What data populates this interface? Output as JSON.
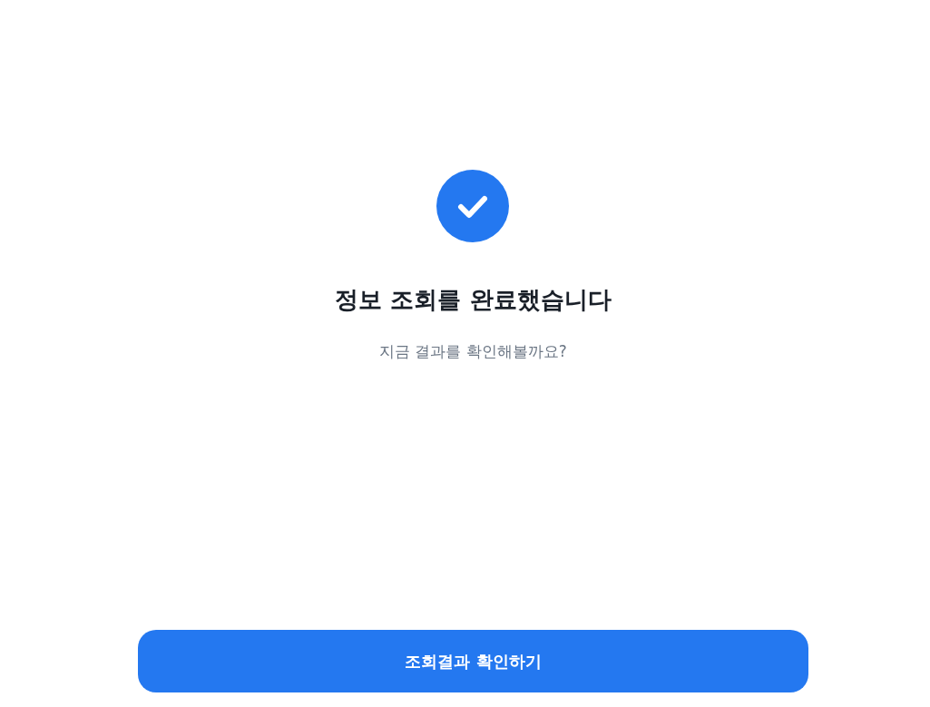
{
  "title": "정보 조회를 완료했습니다",
  "subtitle": "지금 결과를 확인해볼까요?",
  "button": {
    "label": "조회결과 확인하기"
  }
}
